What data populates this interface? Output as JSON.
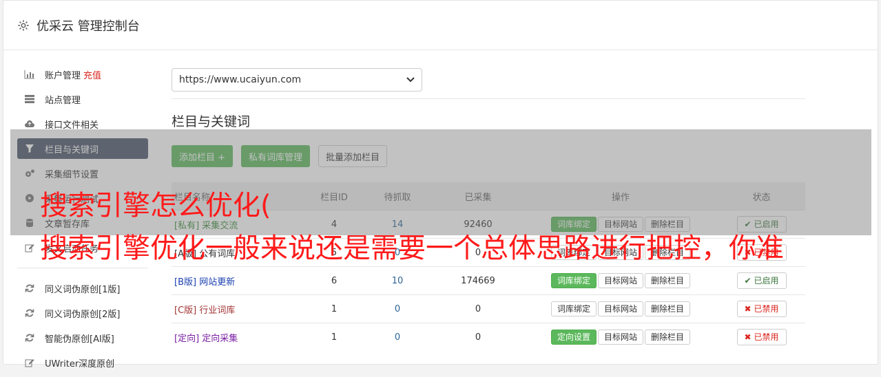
{
  "header": {
    "title": "优采云 管理控制台"
  },
  "sidebar": {
    "items": [
      {
        "label": "账户管理",
        "extra": "充值",
        "icon": "bar-chart-icon"
      },
      {
        "label": "站点管理",
        "icon": "server-icon"
      },
      {
        "label": "接口文件相关",
        "icon": "cloud-upload-icon"
      },
      {
        "label": "栏目与关键词",
        "icon": "filter-icon",
        "active": true
      },
      {
        "label": "采集细节设置",
        "icon": "cogs-icon"
      },
      {
        "label": "采集运行测试",
        "icon": "play-icon"
      },
      {
        "label": "文章暂存库",
        "icon": "database-icon"
      },
      {
        "label": "发文启动任务",
        "icon": "edit-icon"
      }
    ],
    "items2": [
      {
        "label": "同义词伪原创[1版]",
        "icon": "refresh-icon"
      },
      {
        "label": "同义词伪原创[2版]",
        "icon": "refresh-icon"
      },
      {
        "label": "智能伪原创[AI版]",
        "icon": "refresh-icon"
      },
      {
        "label": "UWriter深度原创",
        "icon": "edit-icon"
      }
    ]
  },
  "main": {
    "site_select": "https://www.ucaiyun.com",
    "section_title": "栏目与关键词",
    "buttons": {
      "add": "添加栏目 +",
      "private_lib": "私有词库管理",
      "batch_add": "批量添加栏目"
    },
    "table": {
      "headers": [
        "栏目名称",
        "栏目ID",
        "待抓取",
        "已采集",
        "操作",
        "状态"
      ],
      "rows": [
        {
          "tag": "[私有]",
          "name": "采集交流",
          "id": "4",
          "pending": "14",
          "collected": "92460",
          "op1": "词库绑定",
          "op2": "目标网站",
          "op3": "删除栏目",
          "status": "已启用",
          "on": true,
          "op1_green": true
        },
        {
          "tag": "[A版]",
          "name": "公有词库",
          "id": "5",
          "pending": "0",
          "collected": "0",
          "op1": "词库绑定",
          "op2": "目标网站",
          "op3": "删除栏目",
          "status": "已禁用",
          "on": false,
          "op1_green": false
        },
        {
          "tag": "[B版]",
          "name": "网站更新",
          "id": "6",
          "pending": "10",
          "collected": "174669",
          "op1": "词库绑定",
          "op2": "目标网站",
          "op3": "删除栏目",
          "status": "已启用",
          "on": true,
          "op1_green": true
        },
        {
          "tag": "[C版]",
          "name": "行业词库",
          "id": "1",
          "pending": "0",
          "collected": "0",
          "op1": "词库绑定",
          "op2": "目标网站",
          "op3": "删除栏目",
          "status": "已禁用",
          "on": false,
          "op1_green": false
        },
        {
          "tag": "[定向]",
          "name": "定向采集",
          "id": "1",
          "pending": "0",
          "collected": "0",
          "op1": "定向设置",
          "op2": "目标网站",
          "op3": "删除栏目",
          "status": "已禁用",
          "on": false,
          "op1_green": true
        }
      ]
    }
  },
  "overlay": {
    "line1": "搜索引擎怎么优化(",
    "line2": "搜索引擎优化一般来说还是需要一个总体思路进行把控，你准"
  }
}
